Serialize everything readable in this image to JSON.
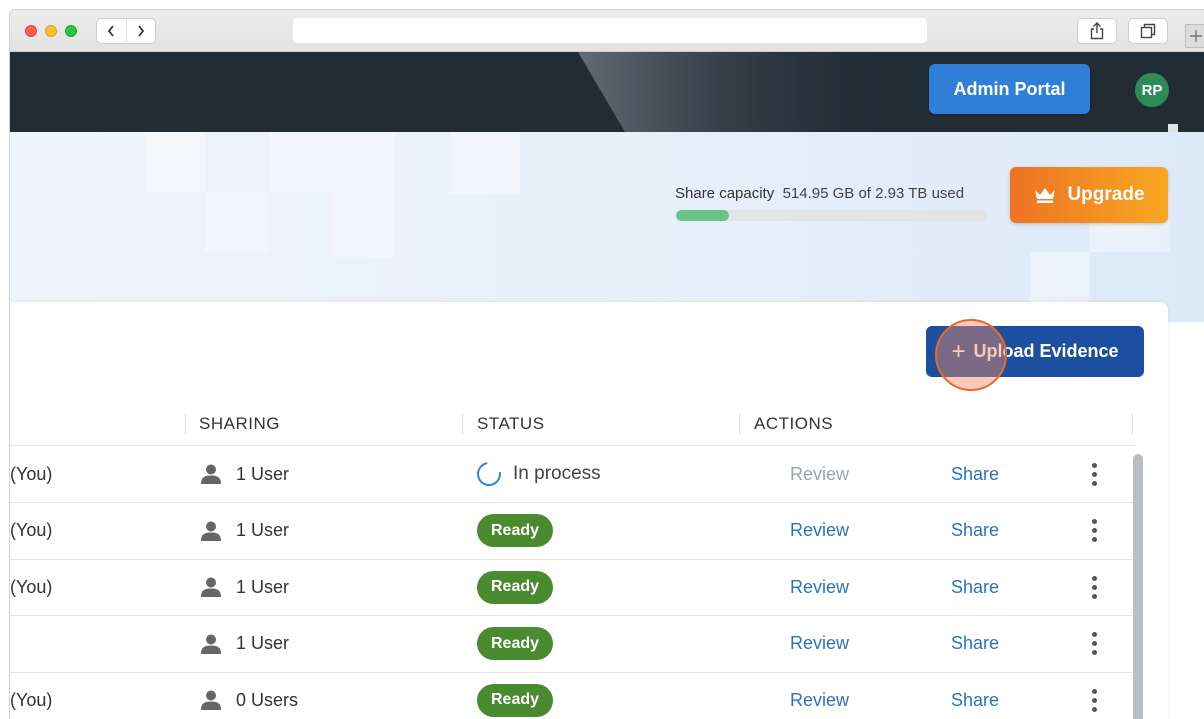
{
  "header": {
    "admin_label": "Admin Portal",
    "avatar_initials": "RP"
  },
  "capacity": {
    "label": "Share capacity",
    "value": "514.95 GB of 2.93 TB used",
    "percent": 17
  },
  "upgrade_label": "Upgrade",
  "upload_label": "Upload Evidence",
  "table": {
    "columns": [
      "SHARING",
      "STATUS",
      "ACTIONS"
    ],
    "rows": [
      {
        "owner": "(You)",
        "sharing": "1 User",
        "status": "In process",
        "status_type": "processing",
        "review": "Review",
        "review_enabled": false,
        "share": "Share"
      },
      {
        "owner": "(You)",
        "sharing": "1 User",
        "status": "Ready",
        "status_type": "ready",
        "review": "Review",
        "review_enabled": true,
        "share": "Share"
      },
      {
        "owner": "(You)",
        "sharing": "1 User",
        "status": "Ready",
        "status_type": "ready",
        "review": "Review",
        "review_enabled": true,
        "share": "Share"
      },
      {
        "owner": "",
        "sharing": "1 User",
        "status": "Ready",
        "status_type": "ready",
        "review": "Review",
        "review_enabled": true,
        "share": "Share"
      },
      {
        "owner": "(You)",
        "sharing": "0 Users",
        "status": "Ready",
        "status_type": "ready",
        "review": "Review",
        "review_enabled": true,
        "share": "Share"
      }
    ]
  },
  "colors": {
    "appbar": "#222c35",
    "admin_button": "#2f7fd8",
    "upload_button": "#1d4fa0",
    "ready_badge": "#4b8b30",
    "link": "#2b72c0",
    "upgrade_start": "#ee7324",
    "upgrade_end": "#f8a722"
  }
}
